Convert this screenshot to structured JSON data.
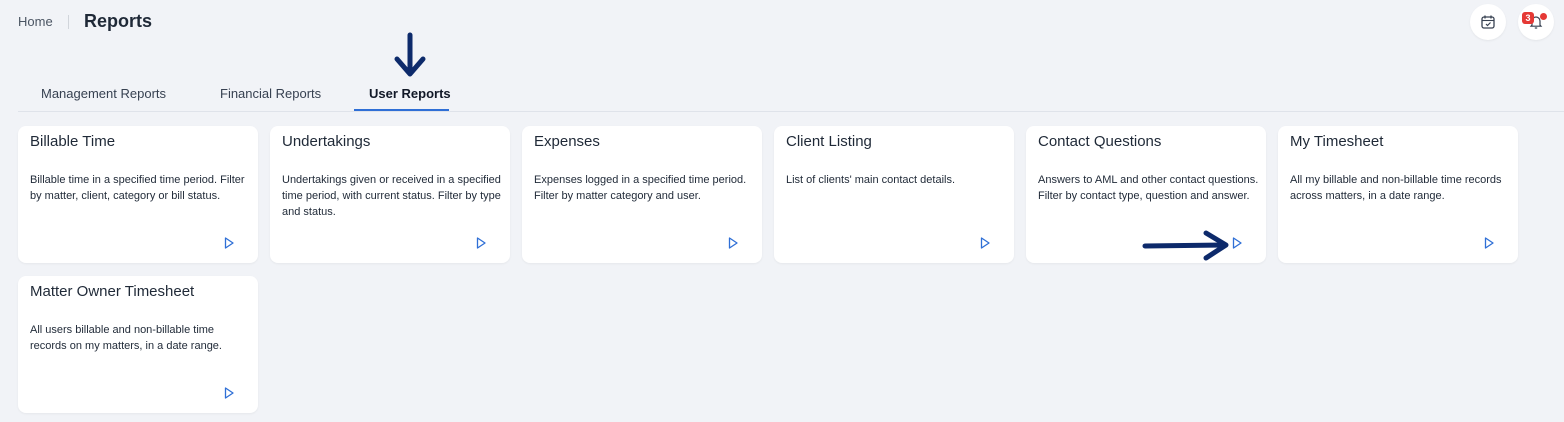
{
  "breadcrumb": {
    "home": "Home",
    "title": "Reports"
  },
  "header": {
    "calendar_icon": "calendar-check-icon",
    "bell_icon": "bell-icon",
    "notification_count": "3"
  },
  "tabs": [
    {
      "label": "Management Reports",
      "active": false
    },
    {
      "label": "Financial Reports",
      "active": false
    },
    {
      "label": "User Reports",
      "active": true
    }
  ],
  "cards": [
    {
      "title": "Billable Time",
      "description": "Billable time in a specified time period. Filter by matter, client, category or bill status."
    },
    {
      "title": "Undertakings",
      "description": "Undertakings given or received in a specified time period, with current status. Filter by type and status."
    },
    {
      "title": "Expenses",
      "description": "Expenses logged in a specified time period. Filter by matter category and user."
    },
    {
      "title": "Client Listing",
      "description": "List of clients' main contact details."
    },
    {
      "title": "Contact Questions",
      "description": "Answers to AML and other contact questions. Filter by contact type, question and answer."
    },
    {
      "title": "My Timesheet",
      "description": "All my billable and non-billable time records across matters, in a date range."
    },
    {
      "title": "Matter Owner Timesheet",
      "description": "All users billable and non-billable time records on my matters, in a date range."
    }
  ],
  "colors": {
    "accent": "#2f6fd6",
    "annotation_arrow": "#0d2a6b",
    "badge": "#e53935",
    "background": "#f1f3f7"
  }
}
